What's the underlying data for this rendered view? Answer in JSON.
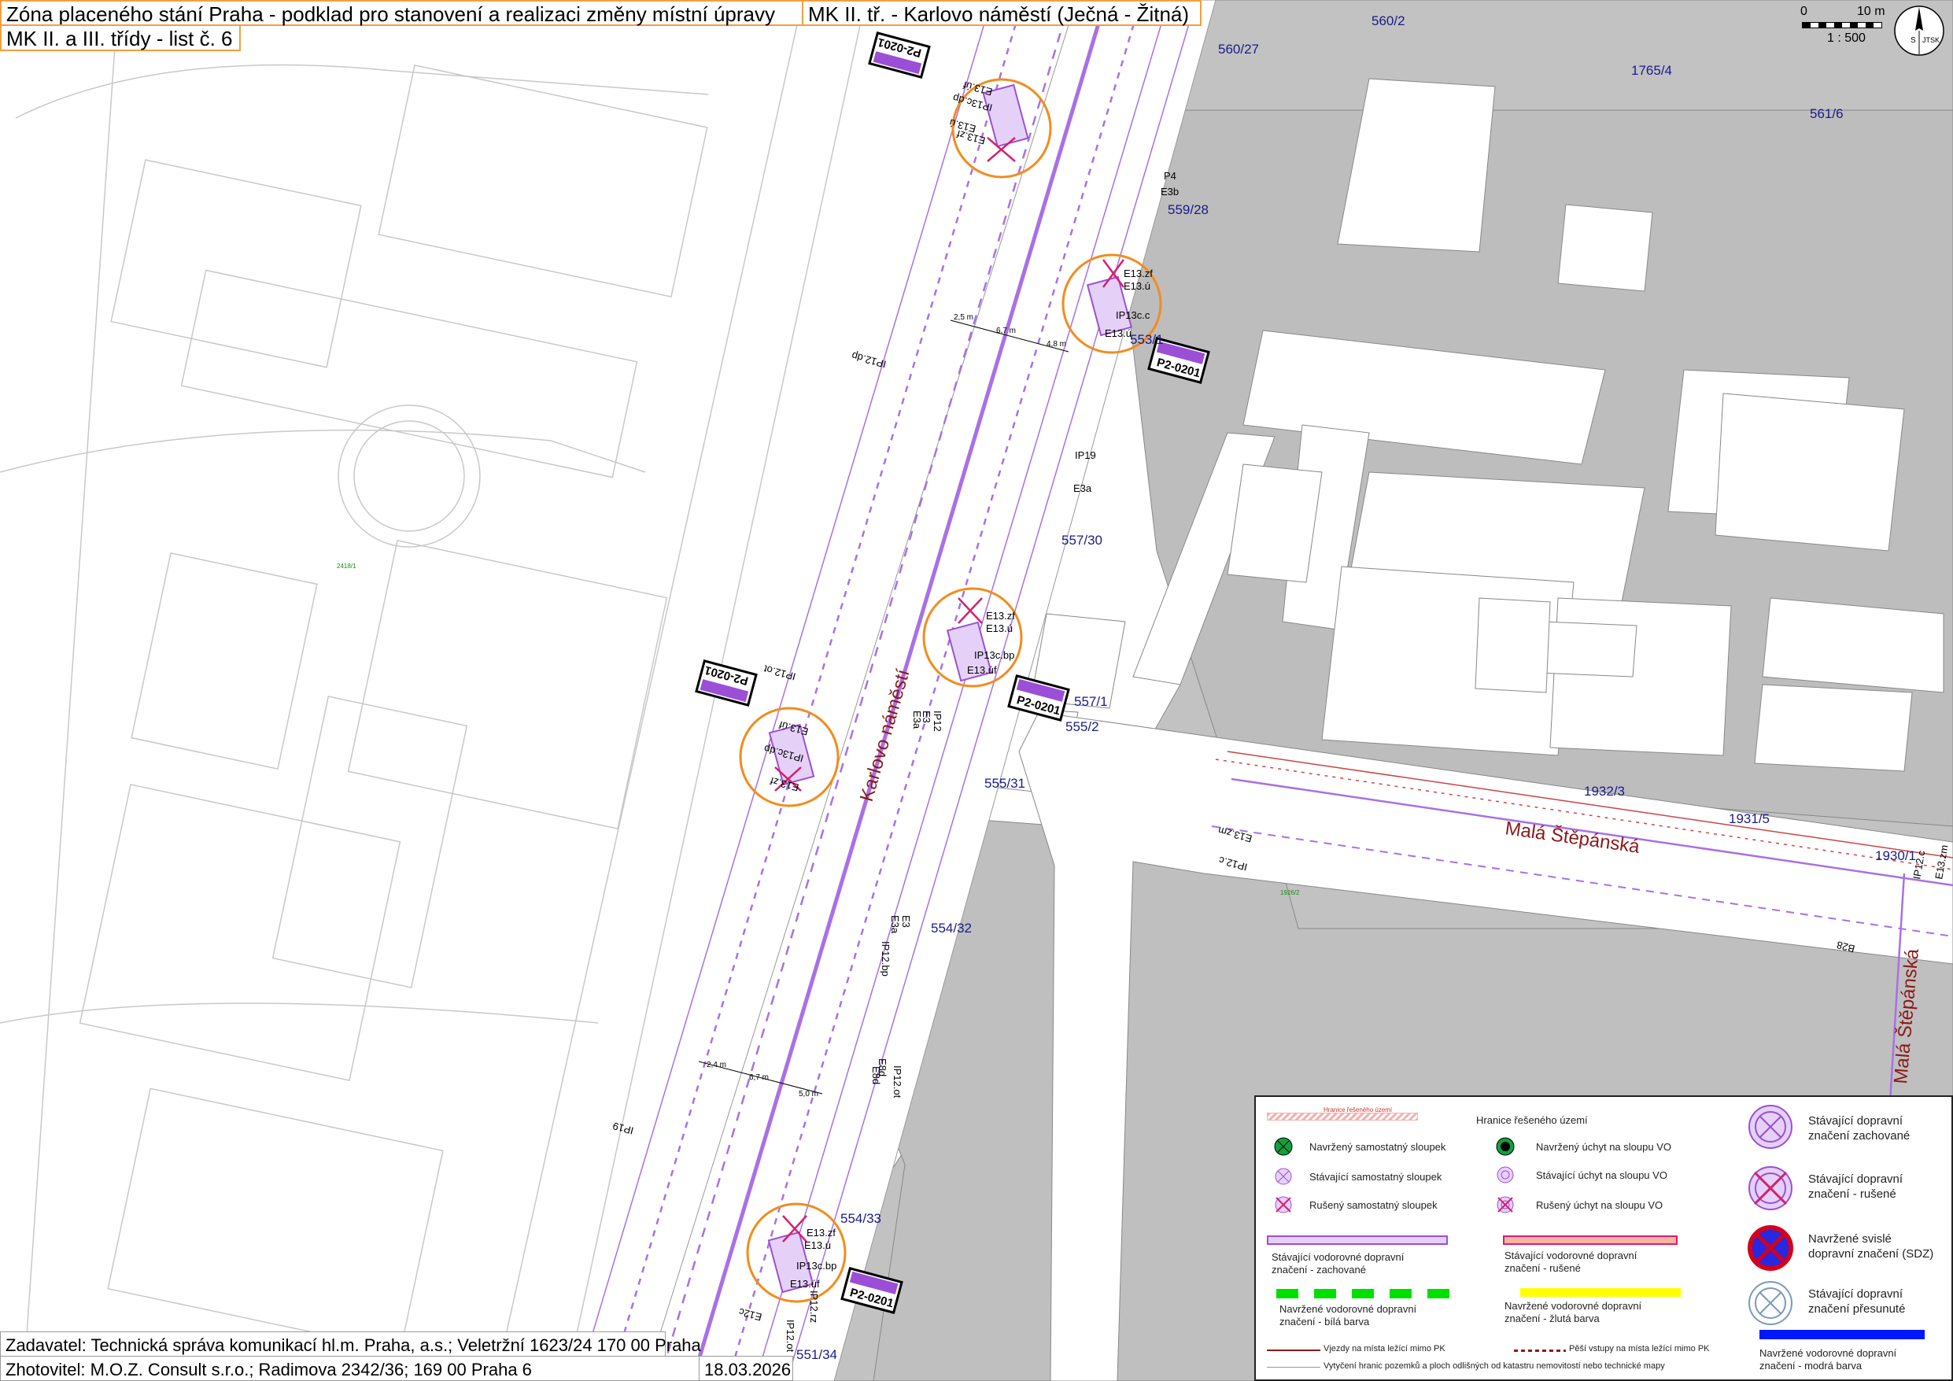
{
  "title": {
    "line1": "Zóna placeného stání Praha - podklad pro stanovení a realizaci změny místní úpravy",
    "line2": "MK II. tř. - Karlovo náměstí (Ječná - Žitná)",
    "line3": "MK II. a III. třídy - list č. 6"
  },
  "footer": {
    "zadavatel": "Zadavatel: Technická správa komunikací hl.m. Praha, a.s.; Veletržní 1623/24 170 00 Praha",
    "zhotovitel": "Zhotovitel: M.O.Z. Consult s.r.o.; Radimova 2342/36; 169 00 Praha 6",
    "date": "18.03.2026"
  },
  "scale": {
    "zero": "0",
    "ten": "10 m",
    "ratio": "1 : 500"
  },
  "north_arrow": {
    "s": "S",
    "label": "JTSK"
  },
  "streets": {
    "karlovo": "Karlovo náměstí",
    "mala_h": "Malá Štěpánská",
    "mala_v": "Malá Štěpánská"
  },
  "parcels": [
    "560/2",
    "560/27",
    "1765/4",
    "561/6",
    "559/28",
    "553/1",
    "557/30",
    "557/1",
    "555/2",
    "555/31",
    "1932/3",
    "1931/5",
    "1930/1",
    "554/32",
    "554/33",
    "551/34",
    "2418/1",
    "1926/2"
  ],
  "sign_boxes": [
    "P2-0201",
    "P2-0201",
    "P2-0201",
    "P2-0201",
    "P2-0201"
  ],
  "sign_codes": [
    "E13.zf",
    "E13.ú",
    "IP13c.c",
    "E13.ú",
    "E13.zf",
    "E13.ú",
    "IP13c.bp",
    "E13.úf",
    "E13.zf",
    "E13.ú",
    "IP13c.bp",
    "E13.úf",
    "IP12.ot",
    "IP13c.dp",
    "E13.úf",
    "E13.zf",
    "E13.ú",
    "IP13c.dp",
    "E13.úf",
    "E13.zf",
    "P4",
    "E3b",
    "IP19",
    "E3a",
    "IP12.dp",
    "IP12",
    "E3a",
    "E3",
    "IP12.bp",
    "E3",
    "E3a",
    "E8d",
    "IP12.ot",
    "IP12.ot",
    "IP12.rz",
    "E12c",
    "IP12.c",
    "E13.zm",
    "B28",
    "IP12.c",
    "E13.zm",
    "E8d",
    "IP19"
  ],
  "dims": [
    "2,5 m",
    "6,7 m",
    "4,8 m",
    "2,4 m",
    "6,7 m",
    "5,0 m"
  ],
  "legend": {
    "hranice_red": "Hranice řešeného území",
    "hranice": "Hranice řešeného území",
    "navrzeny_sloupek": "Navržený samostatný sloupek",
    "stavajici_sloupek": "Stávající samostatný sloupek",
    "ruseny_sloupek": "Rušený samostatný sloupek",
    "navrzeny_uchyt": "Navržený úchyt na sloupu VO",
    "stavajici_uchyt": "Stávající úchyt na sloupu VO",
    "ruseny_uchyt": "Rušený úchyt na sloupu VO",
    "sdz_zachovane": "Stávající dopravní\nznačení zachované",
    "sdz_rusene": "Stávající dopravní\nznačení - rušené",
    "sdz_navrzene": "Navržené svislé\ndopravní značení (SDZ)",
    "sdz_presunute": "Stávající dopravní\nznačení přesunuté",
    "vdz_zachovane": "Stávající vodorovné dopravní\nznačení - zachované",
    "vdz_rusene": "Stávající vodorovné dopravní\nznačení - rušené",
    "vdz_bila": "Navržené vodorovné dopravní\nznačení - bílá barva",
    "vdz_zluta": "Navržené vodorovné dopravní\nznačení - žlutá barva",
    "vdz_modra": "Navržené vodorovné dopravní\nznačení - modrá barva",
    "vjezdy": "Vjezdy na místa ležící mimo PK",
    "pesi": "Pěší vstupy na místa ležící mimo PK",
    "vytyceni": "Vytyčení hranic pozemků a ploch odlišných od katastru nemovitostí nebo technické mapy"
  },
  "colors": {
    "sign_purple": "#9b4fd6",
    "circle_orange": "#f28c1e",
    "building_gray": "#bdbdbd",
    "road_line": "#a970e6",
    "parcel_blue": "#1a1a8c",
    "street_red": "#8b1a1a",
    "green": "#00e000",
    "yellow": "#ffff00",
    "blue": "#0018ff"
  }
}
